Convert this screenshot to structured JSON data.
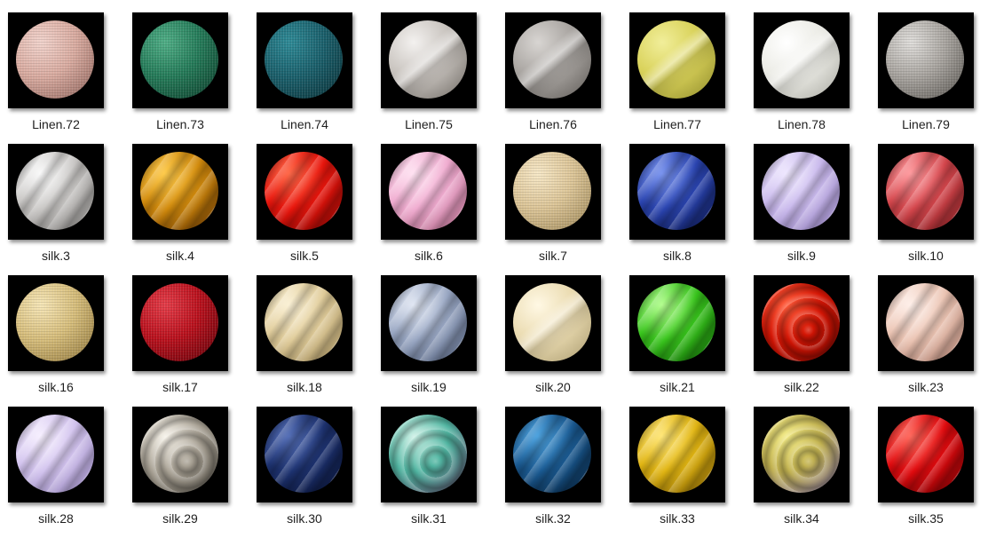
{
  "items": [
    {
      "label": "Linen.72",
      "colors": [
        "#f1d3cc",
        "#d9aba0",
        "#8a6058"
      ],
      "pattern": "weave"
    },
    {
      "label": "Linen.73",
      "colors": [
        "#4fae86",
        "#247a58",
        "#0c3a28"
      ],
      "pattern": "weave"
    },
    {
      "label": "Linen.74",
      "colors": [
        "#2e8a96",
        "#1a5f6b",
        "#0a2e34"
      ],
      "pattern": "weave"
    },
    {
      "label": "Linen.75",
      "colors": [
        "#f3f1ef",
        "#c9c4bf",
        "#6d6862"
      ],
      "pattern": "fold"
    },
    {
      "label": "Linen.76",
      "colors": [
        "#d8d5d2",
        "#a9a5a1",
        "#5d5955"
      ],
      "pattern": "fold"
    },
    {
      "label": "Linen.77",
      "colors": [
        "#f1ee9a",
        "#d9d25a",
        "#8f8a2a"
      ],
      "pattern": "fold"
    },
    {
      "label": "Linen.78",
      "colors": [
        "#ffffff",
        "#ecece6",
        "#a8a8a0"
      ],
      "pattern": "fold"
    },
    {
      "label": "Linen.79",
      "colors": [
        "#e0dedb",
        "#a8a49f",
        "#55524d"
      ],
      "pattern": "weave"
    },
    {
      "label": "silk.3",
      "colors": [
        "#fafafa",
        "#c8c6c4",
        "#777573"
      ],
      "pattern": "wave"
    },
    {
      "label": "silk.4",
      "colors": [
        "#ffcc4d",
        "#d18a0c",
        "#5e3002"
      ],
      "pattern": "wave"
    },
    {
      "label": "silk.5",
      "colors": [
        "#ff6a4a",
        "#e8150c",
        "#7a0402"
      ],
      "pattern": "wave"
    },
    {
      "label": "silk.6",
      "colors": [
        "#ffe3f2",
        "#f0acd0",
        "#a8607f"
      ],
      "pattern": "wave"
    },
    {
      "label": "silk.7",
      "colors": [
        "#f6e7c6",
        "#dcc597",
        "#9a8455"
      ],
      "pattern": "weave"
    },
    {
      "label": "silk.8",
      "colors": [
        "#7c96f0",
        "#2a44b0",
        "#0a1446"
      ],
      "pattern": "wave"
    },
    {
      "label": "silk.9",
      "colors": [
        "#efe8ff",
        "#c9b9ec",
        "#8c7ab6"
      ],
      "pattern": "wave"
    },
    {
      "label": "silk.10",
      "colors": [
        "#ff9ca0",
        "#d4464c",
        "#781a1e"
      ],
      "pattern": "wave"
    },
    {
      "label": "silk.16",
      "colors": [
        "#f6e6b7",
        "#d6bd7b",
        "#8c7339"
      ],
      "pattern": "weave"
    },
    {
      "label": "silk.17",
      "colors": [
        "#e43c48",
        "#b8101c",
        "#5c0209"
      ],
      "pattern": "weave"
    },
    {
      "label": "silk.18",
      "colors": [
        "#fbf1d6",
        "#e0cc9a",
        "#9b8657"
      ],
      "pattern": "wave"
    },
    {
      "label": "silk.19",
      "colors": [
        "#e2e8f4",
        "#98a6c2",
        "#4b5873"
      ],
      "pattern": "wave"
    },
    {
      "label": "silk.20",
      "colors": [
        "#fff8e4",
        "#ebdcb2",
        "#a99a6e"
      ],
      "pattern": "fold"
    },
    {
      "label": "silk.21",
      "colors": [
        "#b6ff92",
        "#38c41c",
        "#0d5c05"
      ],
      "pattern": "wave"
    },
    {
      "label": "silk.22",
      "colors": [
        "#ff5a3a",
        "#d41504",
        "#6c0500"
      ],
      "pattern": "swirl"
    },
    {
      "label": "silk.23",
      "colors": [
        "#fff0ea",
        "#ebc4b3",
        "#a6786a"
      ],
      "pattern": "wave"
    },
    {
      "label": "silk.28",
      "colors": [
        "#f7f0ff",
        "#d2c3ee",
        "#8f7fb5"
      ],
      "pattern": "wave"
    },
    {
      "label": "silk.29",
      "colors": [
        "#f5f1e8",
        "#a8a194",
        "#4e4a42"
      ],
      "pattern": "swirl"
    },
    {
      "label": "silk.30",
      "colors": [
        "#5670b8",
        "#1d3270",
        "#070f2d"
      ],
      "pattern": "wave"
    },
    {
      "label": "silk.31",
      "colors": [
        "#c9efe4",
        "#4fb4a0",
        "#5a3b5e"
      ],
      "pattern": "swirl"
    },
    {
      "label": "silk.32",
      "colors": [
        "#4fa4e0",
        "#1a5a92",
        "#051c33"
      ],
      "pattern": "wave"
    },
    {
      "label": "silk.33",
      "colors": [
        "#ffe77a",
        "#e0b412",
        "#7a5a02"
      ],
      "pattern": "wave"
    },
    {
      "label": "silk.34",
      "colors": [
        "#f2ea86",
        "#c2b250",
        "#7a6aa4"
      ],
      "pattern": "swirl"
    },
    {
      "label": "silk.35",
      "colors": [
        "#ff6a5e",
        "#e00a0e",
        "#6a0002"
      ],
      "pattern": "wave"
    }
  ]
}
